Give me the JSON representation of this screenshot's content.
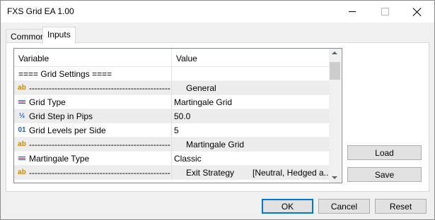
{
  "window": {
    "title": "FXS Grid EA 1.00"
  },
  "tabs": [
    {
      "label": "Common"
    },
    {
      "label": "Inputs"
    }
  ],
  "grid": {
    "columns": [
      "Variable",
      "Value"
    ],
    "rows": [
      {
        "icon": "none",
        "name": "==== Grid Settings ====",
        "value": "",
        "value2": ""
      },
      {
        "icon": "ab",
        "name": "--------------------------------------------------...",
        "value": "General",
        "value2": ""
      },
      {
        "icon": "list",
        "name": "Grid Type",
        "value": "Martingale Grid",
        "value2": ""
      },
      {
        "icon": "half",
        "name": "Grid Step in Pips",
        "value": "50.0",
        "value2": ""
      },
      {
        "icon": "int",
        "name": "Grid Levels per Side",
        "value": "5",
        "value2": ""
      },
      {
        "icon": "ab",
        "name": "--------------------------------------------------...",
        "value": "Martingale Grid",
        "value2": ""
      },
      {
        "icon": "list",
        "name": "Martingale Type",
        "value": "Classic",
        "value2": ""
      },
      {
        "icon": "ab",
        "name": "--------------------------------------------------...",
        "value": "Exit Strategy",
        "value2": "[Neutral, Hedged a..."
      }
    ]
  },
  "buttons": {
    "load": "Load",
    "save": "Save",
    "ok": "OK",
    "cancel": "Cancel",
    "reset": "Reset"
  },
  "icons": {
    "ab": "ab",
    "half": "½",
    "int": "01"
  }
}
